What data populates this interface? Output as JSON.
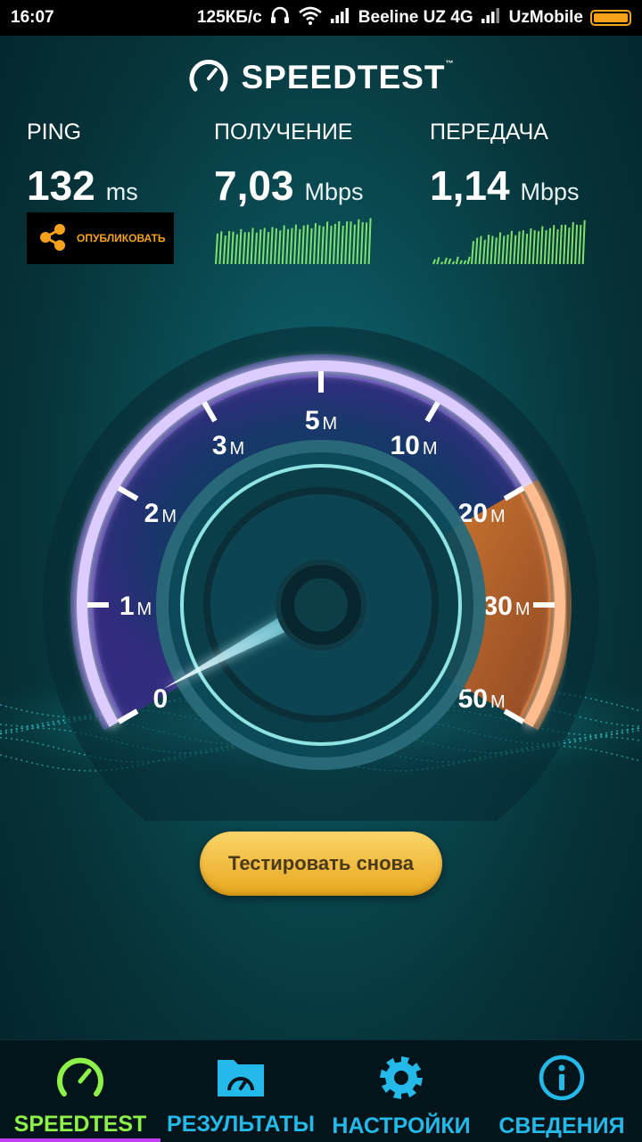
{
  "status_bar": {
    "time": "16:07",
    "speed": "125КБ/с",
    "carrier1": "Beeline UZ 4G",
    "carrier2": "UzMobile",
    "icons": [
      "headphones-icon",
      "wifi-icon",
      "signal-icon",
      "signal-icon",
      "battery-icon"
    ],
    "battery_color": "#f7a21b"
  },
  "logo": {
    "text": "SPEEDTEST",
    "tm": "™"
  },
  "metrics": {
    "ping": {
      "label": "PING",
      "value": "132",
      "unit": "ms"
    },
    "download": {
      "label": "ПОЛУЧЕНИЕ",
      "value": "7,03",
      "unit": "Mbps"
    },
    "upload": {
      "label": "ПЕРЕДАЧА",
      "value": "1,14",
      "unit": "Mbps"
    }
  },
  "share": {
    "label": "ОПУБЛИКОВАТЬ",
    "icon": "share-icon"
  },
  "gauge": {
    "ticks": [
      {
        "num": "0",
        "suffix": ""
      },
      {
        "num": "1",
        "suffix": "M"
      },
      {
        "num": "2",
        "suffix": "M"
      },
      {
        "num": "3",
        "suffix": "M"
      },
      {
        "num": "5",
        "suffix": "M"
      },
      {
        "num": "10",
        "suffix": "M"
      },
      {
        "num": "20",
        "suffix": "M"
      },
      {
        "num": "30",
        "suffix": "M"
      },
      {
        "num": "50",
        "suffix": "M"
      }
    ]
  },
  "retest": {
    "label": "Тестировать снова"
  },
  "nav": {
    "items": [
      {
        "label": "SPEEDTEST",
        "icon": "speedometer-icon",
        "active": true
      },
      {
        "label": "РЕЗУЛЬТАТЫ",
        "icon": "results-folder-icon",
        "active": false
      },
      {
        "label": "НАСТРОЙКИ",
        "icon": "gear-icon",
        "active": false
      },
      {
        "label": "СВЕДЕНИЯ",
        "icon": "info-icon",
        "active": false
      }
    ]
  },
  "colors": {
    "accent_orange": "#f7a21b",
    "nav_active": "#8cf24a",
    "nav_inactive": "#23b9e8",
    "gauge_purple": "#9d6cff",
    "gauge_orange": "#ff8a3a"
  }
}
